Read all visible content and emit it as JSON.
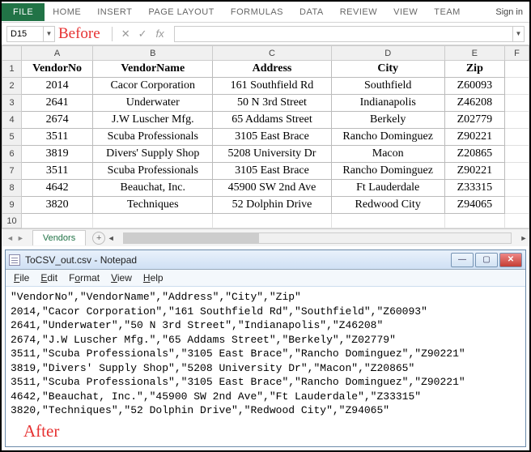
{
  "ribbon": {
    "file": "FILE",
    "tabs": [
      "HOME",
      "INSERT",
      "PAGE LAYOUT",
      "FORMULAS",
      "DATA",
      "REVIEW",
      "VIEW",
      "TEAM"
    ],
    "signin": "Sign in"
  },
  "namebox": "D15",
  "before_label": "Before",
  "fx_label": "fx",
  "columns": [
    "A",
    "B",
    "C",
    "D",
    "E",
    "F"
  ],
  "row_numbers": [
    "1",
    "2",
    "3",
    "4",
    "5",
    "6",
    "7",
    "8",
    "9",
    "10"
  ],
  "headers": [
    "VendorNo",
    "VendorName",
    "Address",
    "City",
    "Zip"
  ],
  "rows": [
    [
      "2014",
      "Cacor Corporation",
      "161 Southfield Rd",
      "Southfield",
      "Z60093"
    ],
    [
      "2641",
      "Underwater",
      "50 N 3rd Street",
      "Indianapolis",
      "Z46208"
    ],
    [
      "2674",
      "J.W Luscher Mfg.",
      "65 Addams Street",
      "Berkely",
      "Z02779"
    ],
    [
      "3511",
      "Scuba Professionals",
      "3105 East Brace",
      "Rancho Dominguez",
      "Z90221"
    ],
    [
      "3819",
      "Divers' Supply Shop",
      "5208 University Dr",
      "Macon",
      "Z20865"
    ],
    [
      "3511",
      "Scuba Professionals",
      "3105 East Brace",
      "Rancho Dominguez",
      "Z90221"
    ],
    [
      "4642",
      "Beauchat, Inc.",
      "45900 SW 2nd Ave",
      "Ft Lauderdale",
      "Z33315"
    ],
    [
      "3820",
      "Techniques",
      "52 Dolphin Drive",
      "Redwood City",
      "Z94065"
    ]
  ],
  "sheet_tab": "Vendors",
  "notepad": {
    "title": "ToCSV_out.csv - Notepad",
    "menu": [
      "File",
      "Edit",
      "Format",
      "View",
      "Help"
    ],
    "lines": [
      "\"VendorNo\",\"VendorName\",\"Address\",\"City\",\"Zip\"",
      "2014,\"Cacor Corporation\",\"161 Southfield Rd\",\"Southfield\",\"Z60093\"",
      "2641,\"Underwater\",\"50 N 3rd Street\",\"Indianapolis\",\"Z46208\"",
      "2674,\"J.W Luscher Mfg.\",\"65 Addams Street\",\"Berkely\",\"Z02779\"",
      "3511,\"Scuba Professionals\",\"3105 East Brace\",\"Rancho Dominguez\",\"Z90221\"",
      "3819,\"Divers' Supply Shop\",\"5208 University Dr\",\"Macon\",\"Z20865\"",
      "3511,\"Scuba Professionals\",\"3105 East Brace\",\"Rancho Dominguez\",\"Z90221\"",
      "4642,\"Beauchat, Inc.\",\"45900 SW 2nd Ave\",\"Ft Lauderdale\",\"Z33315\"",
      "3820,\"Techniques\",\"52 Dolphin Drive\",\"Redwood City\",\"Z94065\""
    ]
  },
  "after_label": "After"
}
